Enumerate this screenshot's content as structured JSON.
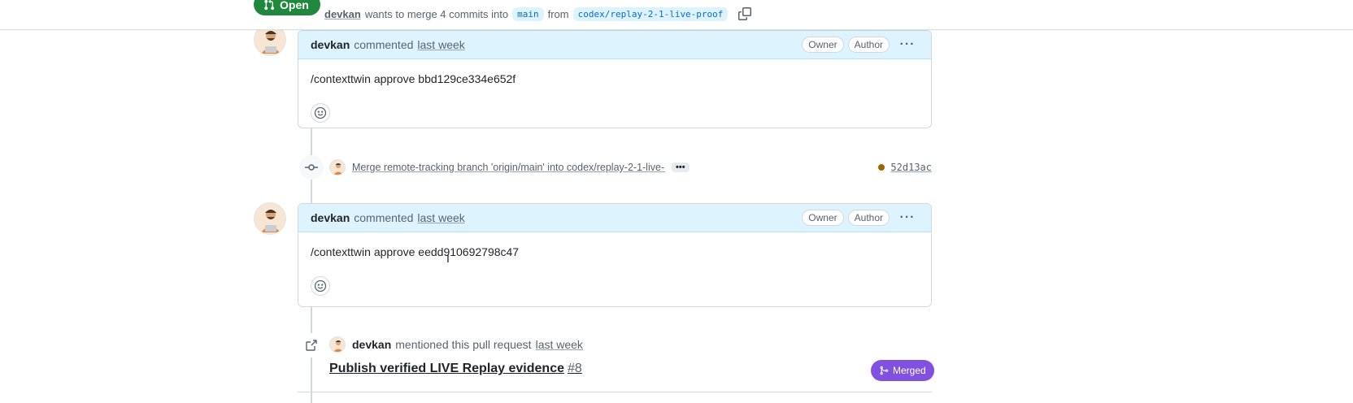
{
  "header": {
    "state_label": "Open",
    "author": "devkan",
    "wants_text": "wants to merge 4 commits into",
    "base_branch": "main",
    "from_text": "from",
    "head_branch": "codex/replay-2-1-live-proof"
  },
  "comments": [
    {
      "author": "devkan",
      "action": "commented",
      "timestamp": "last week",
      "badges": [
        "Owner",
        "Author"
      ],
      "body": "/contexttwin approve bbd129ce334e652f"
    },
    {
      "author": "devkan",
      "action": "commented",
      "timestamp": "last week",
      "badges": [
        "Owner",
        "Author"
      ],
      "body": "/contexttwin approve eedd910692798c47"
    }
  ],
  "commit": {
    "message": "Merge remote-tracking branch 'origin/main' into codex/replay-2-1-live-…",
    "ellipsis": "•••",
    "status_color": "#9a6700",
    "sha": "52d13ac"
  },
  "mention": {
    "author": "devkan",
    "text": "mentioned this pull request",
    "timestamp": "last week",
    "pr_title": "Publish verified LIVE Replay evidence",
    "pr_number": "#8",
    "pr_state": "Merged"
  },
  "colors": {
    "open_green": "#1f883d",
    "merged_purple": "#8250df",
    "comment_header_bg": "#ddf4ff"
  }
}
